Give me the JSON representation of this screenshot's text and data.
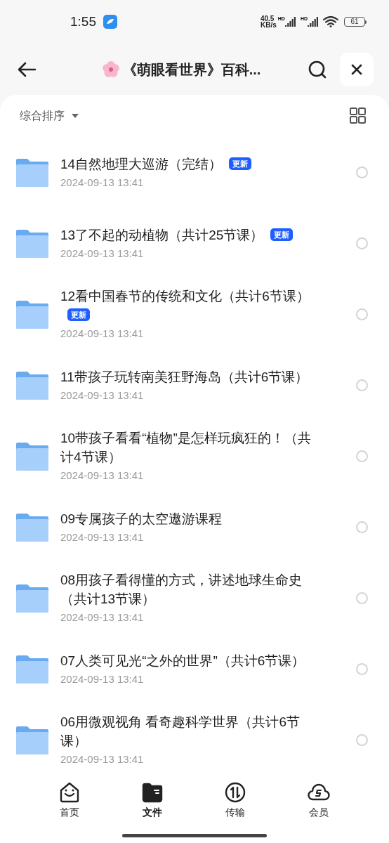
{
  "status_bar": {
    "time": "1:55",
    "speed": "40.5",
    "speed_unit": "KB/s",
    "network_1": "HD",
    "network_2": "HD",
    "battery": "61"
  },
  "header": {
    "title": "《萌眼看世界》百科..."
  },
  "sort": {
    "label": "综合排序"
  },
  "files": [
    {
      "name": "14自然地理大巡游（完结）",
      "badge": "更新",
      "date": "2024-09-13 13:41",
      "selected": false
    },
    {
      "name": "13了不起的动植物（共计25节课）",
      "badge": "更新",
      "date": "2024-09-13 13:41",
      "selected": false
    },
    {
      "name": "12看中国春节的传统和文化（共计6节课）",
      "badge": "更新",
      "date": "2024-09-13 13:41",
      "selected": false
    },
    {
      "name": "11带孩子玩转南美狂野海岛（共计6节课）",
      "date": "2024-09-13 13:41",
      "selected": false
    },
    {
      "name": "10带孩子看看“植物”是怎样玩疯狂的！（共计4节课）",
      "date": "2024-09-13 13:41",
      "selected": false
    },
    {
      "name": "09专属孩子的太空遨游课程",
      "date": "2024-09-13 13:41",
      "selected": false
    },
    {
      "name": "08用孩子看得懂的方式，讲述地球生命史（共计13节课）",
      "date": "2024-09-13 13:41",
      "selected": false
    },
    {
      "name": "07人类可见光“之外的世界”（共计6节课）",
      "date": "2024-09-13 13:41",
      "selected": false
    },
    {
      "name": "06用微观视角 看奇趣科学世界（共计6节课）",
      "date": "2024-09-13 13:41",
      "selected": false
    }
  ],
  "tabs": [
    {
      "label": "首页",
      "kind": "home",
      "selected": false
    },
    {
      "label": "文件",
      "kind": "files",
      "selected": true
    },
    {
      "label": "传输",
      "kind": "transfer",
      "selected": false
    },
    {
      "label": "会员",
      "kind": "vip",
      "selected": false
    }
  ]
}
